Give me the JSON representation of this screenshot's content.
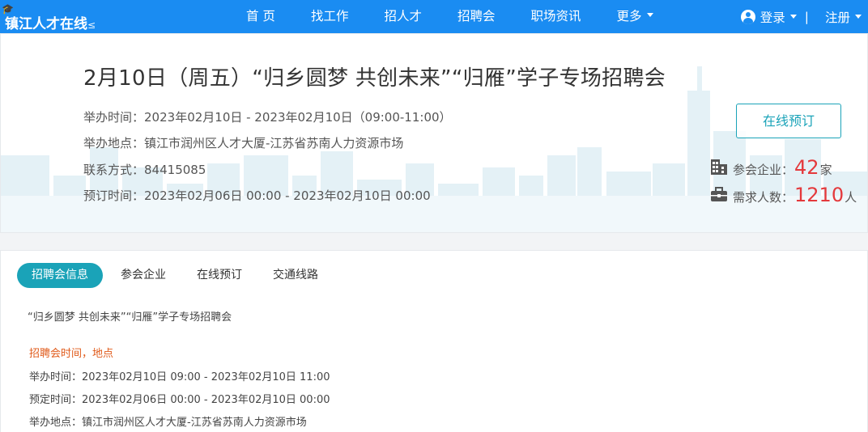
{
  "nav": {
    "logo_text": "镇江人才在线",
    "logo_suffix": "≤",
    "items": [
      {
        "label": "首 页"
      },
      {
        "label": "找工作"
      },
      {
        "label": "招人才"
      },
      {
        "label": "招聘会"
      },
      {
        "label": "职场资讯"
      },
      {
        "label": "更多"
      }
    ],
    "login": "登录",
    "separator": "|",
    "register": "注册"
  },
  "hero": {
    "title": "2月10日（周五）“归乡圆梦 共创未来”“归雁”学子专场招聘会",
    "time_label": "举办时间：",
    "time_value": "2023年02月10日 - 2023年02月10日（09:00-11:00）",
    "place_label": "举办地点：",
    "place_value": "镇江市润州区人才大厦-江苏省苏南人力资源市场",
    "contact_label": "联系方式：",
    "contact_value": "84415085",
    "booking_label": "预订时间：",
    "booking_value": "2023年02月06日 00:00 - 2023年02月10日 00:00",
    "book_button": "在线预订",
    "companies_label": "参会企业：",
    "companies_value": "42",
    "companies_unit": "家",
    "demand_label": "需求人数：",
    "demand_value": "1210",
    "demand_unit": "人",
    "icons": {
      "companies": "building-icon",
      "demand": "briefcase-icon"
    }
  },
  "tabs": [
    {
      "label": "招聘会信息",
      "active": true
    },
    {
      "label": "参会企业",
      "active": false
    },
    {
      "label": "在线预订",
      "active": false
    },
    {
      "label": "交通线路",
      "active": false
    }
  ],
  "content": {
    "subtitle": "“归乡圆梦 共创未来”“归雁”学子专场招聘会",
    "section_title": "招聘会时间，地点",
    "time_label": "举办时间：",
    "time_value": "2023年02月10日 09:00 - 2023年02月10日 11:00",
    "booking_label": "预定时间：",
    "booking_value": "2023年02月06日 00:00 - 2023年02月10日 00:00",
    "place_label": "举办地点：",
    "place_value": "镇江市润州区人才大厦-江苏省苏南人力资源市场"
  },
  "colors": {
    "nav_bg": "#1a8cf2",
    "accent": "#1aa3b8",
    "highlight": "#e4393c",
    "section": "#e05a1a"
  }
}
